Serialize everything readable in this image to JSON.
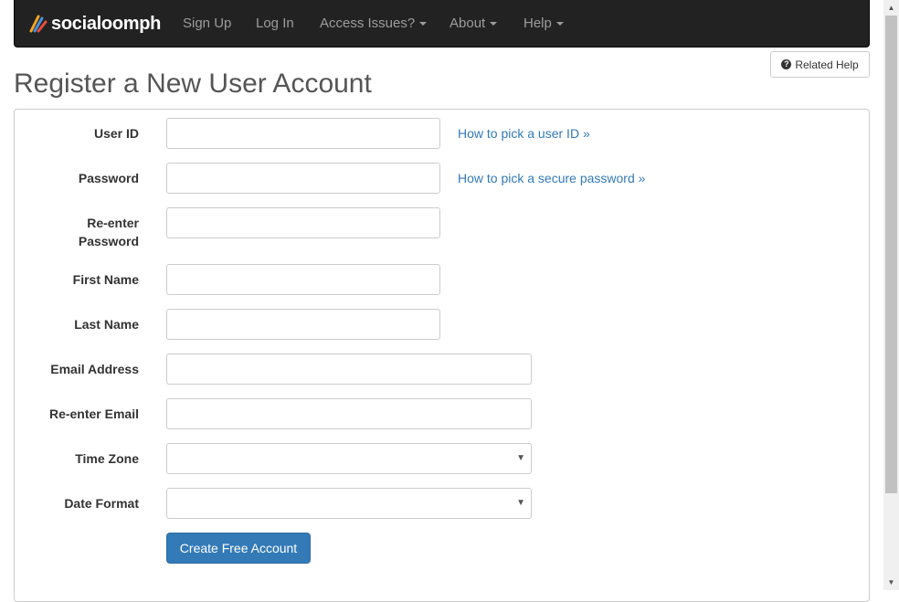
{
  "navbar": {
    "brand": "socialoomph",
    "items": [
      {
        "label": "Sign Up",
        "dropdown": false
      },
      {
        "label": "Log In",
        "dropdown": false
      },
      {
        "label": "Access Issues?",
        "dropdown": true
      },
      {
        "label": "About",
        "dropdown": true
      },
      {
        "label": "Help",
        "dropdown": true
      }
    ]
  },
  "related_help": {
    "icon": "question-circle-icon",
    "label": "Related Help"
  },
  "page_title": "Register a New User Account",
  "form": {
    "fields": [
      {
        "label": "User ID",
        "value": "",
        "help": "How to pick a user ID »"
      },
      {
        "label": "Password",
        "value": "",
        "help": "How to pick a secure password »"
      },
      {
        "label": "Re-enter Password",
        "label_line1": "Re-enter",
        "label_line2": "Password",
        "value": ""
      },
      {
        "label": "First Name",
        "value": ""
      },
      {
        "label": "Last Name",
        "value": ""
      },
      {
        "label": "Email Address",
        "value": ""
      },
      {
        "label": "Re-enter Email",
        "value": ""
      },
      {
        "label": "Time Zone",
        "value": ""
      },
      {
        "label": "Date Format",
        "value": ""
      }
    ],
    "submit_label": "Create Free Account"
  },
  "colors": {
    "navbar_bg": "#222222",
    "nav_text": "#9d9d9d",
    "link": "#337ab7",
    "primary_button": "#337ab7"
  }
}
